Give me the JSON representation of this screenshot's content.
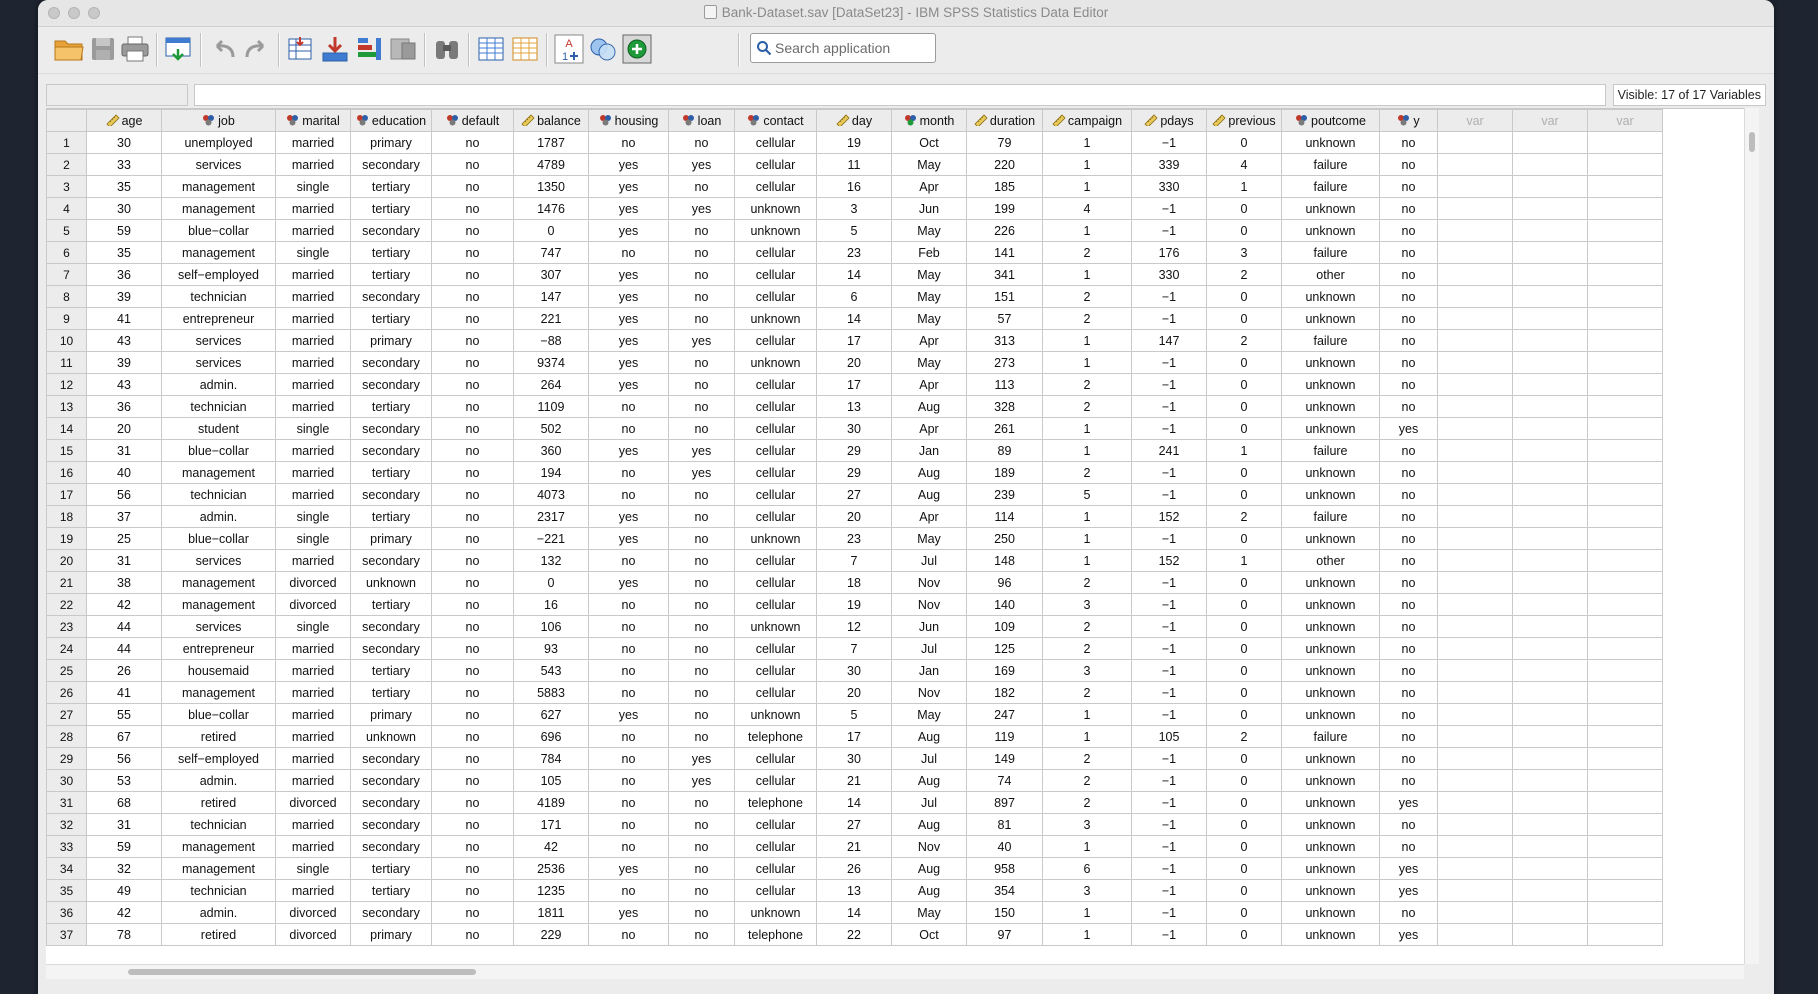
{
  "window": {
    "title": "Bank-Dataset.sav [DataSet23] - IBM SPSS Statistics Data Editor"
  },
  "toolbar": {
    "buttons": [
      {
        "name": "open-data-document",
        "icon": "folder-open-icon"
      },
      {
        "name": "save-document",
        "icon": "save-disk-icon"
      },
      {
        "name": "print",
        "icon": "printer-icon"
      },
      {
        "name": "recall-dialog",
        "icon": "recall-dialog-icon"
      },
      {
        "name": "undo",
        "icon": "undo-arrow-icon"
      },
      {
        "name": "redo",
        "icon": "redo-arrow-icon"
      },
      {
        "name": "go-to-case",
        "icon": "go-to-case-icon"
      },
      {
        "name": "go-to-variable",
        "icon": "go-to-variable-icon"
      },
      {
        "name": "variables",
        "icon": "variables-list-icon"
      },
      {
        "name": "run-descriptive-statistics",
        "icon": "descriptives-icon"
      },
      {
        "name": "find",
        "icon": "binoculars-icon"
      },
      {
        "name": "insert-cases",
        "icon": "insert-cases-icon"
      },
      {
        "name": "insert-variable",
        "icon": "insert-variable-icon"
      },
      {
        "name": "split-file",
        "icon": "split-file-icon"
      },
      {
        "name": "value-labels",
        "icon": "value-labels-icon"
      },
      {
        "name": "use-variable-sets",
        "icon": "use-sets-icon"
      },
      {
        "name": "customize-toolbar",
        "icon": "add-plus-icon"
      }
    ],
    "search_placeholder": "Search application"
  },
  "status": {
    "visible_vars": "Visible: 17 of 17 Variables"
  },
  "grid": {
    "columns": [
      {
        "name": "age",
        "type": "scale"
      },
      {
        "name": "job",
        "type": "nominal"
      },
      {
        "name": "marital",
        "type": "nominal"
      },
      {
        "name": "education",
        "type": "nominal"
      },
      {
        "name": "default",
        "type": "nominal"
      },
      {
        "name": "balance",
        "type": "scale"
      },
      {
        "name": "housing",
        "type": "nominal"
      },
      {
        "name": "loan",
        "type": "nominal"
      },
      {
        "name": "contact",
        "type": "nominal"
      },
      {
        "name": "day",
        "type": "scale"
      },
      {
        "name": "month",
        "type": "nominal-multi"
      },
      {
        "name": "duration",
        "type": "scale"
      },
      {
        "name": "campaign",
        "type": "scale"
      },
      {
        "name": "pdays",
        "type": "scale"
      },
      {
        "name": "previous",
        "type": "scale"
      },
      {
        "name": "poutcome",
        "type": "nominal"
      },
      {
        "name": "y",
        "type": "nominal"
      }
    ],
    "empty_columns": [
      "var",
      "var",
      "var"
    ],
    "rows": [
      [
        "30",
        "unemployed",
        "married",
        "primary",
        "no",
        "1787",
        "no",
        "no",
        "cellular",
        "19",
        "Oct",
        "79",
        "1",
        "-1",
        "0",
        "unknown",
        "no"
      ],
      [
        "33",
        "services",
        "married",
        "secondary",
        "no",
        "4789",
        "yes",
        "yes",
        "cellular",
        "11",
        "May",
        "220",
        "1",
        "339",
        "4",
        "failure",
        "no"
      ],
      [
        "35",
        "management",
        "single",
        "tertiary",
        "no",
        "1350",
        "yes",
        "no",
        "cellular",
        "16",
        "Apr",
        "185",
        "1",
        "330",
        "1",
        "failure",
        "no"
      ],
      [
        "30",
        "management",
        "married",
        "tertiary",
        "no",
        "1476",
        "yes",
        "yes",
        "unknown",
        "3",
        "Jun",
        "199",
        "4",
        "-1",
        "0",
        "unknown",
        "no"
      ],
      [
        "59",
        "blue-collar",
        "married",
        "secondary",
        "no",
        "0",
        "yes",
        "no",
        "unknown",
        "5",
        "May",
        "226",
        "1",
        "-1",
        "0",
        "unknown",
        "no"
      ],
      [
        "35",
        "management",
        "single",
        "tertiary",
        "no",
        "747",
        "no",
        "no",
        "cellular",
        "23",
        "Feb",
        "141",
        "2",
        "176",
        "3",
        "failure",
        "no"
      ],
      [
        "36",
        "self-employed",
        "married",
        "tertiary",
        "no",
        "307",
        "yes",
        "no",
        "cellular",
        "14",
        "May",
        "341",
        "1",
        "330",
        "2",
        "other",
        "no"
      ],
      [
        "39",
        "technician",
        "married",
        "secondary",
        "no",
        "147",
        "yes",
        "no",
        "cellular",
        "6",
        "May",
        "151",
        "2",
        "-1",
        "0",
        "unknown",
        "no"
      ],
      [
        "41",
        "entrepreneur",
        "married",
        "tertiary",
        "no",
        "221",
        "yes",
        "no",
        "unknown",
        "14",
        "May",
        "57",
        "2",
        "-1",
        "0",
        "unknown",
        "no"
      ],
      [
        "43",
        "services",
        "married",
        "primary",
        "no",
        "-88",
        "yes",
        "yes",
        "cellular",
        "17",
        "Apr",
        "313",
        "1",
        "147",
        "2",
        "failure",
        "no"
      ],
      [
        "39",
        "services",
        "married",
        "secondary",
        "no",
        "9374",
        "yes",
        "no",
        "unknown",
        "20",
        "May",
        "273",
        "1",
        "-1",
        "0",
        "unknown",
        "no"
      ],
      [
        "43",
        "admin.",
        "married",
        "secondary",
        "no",
        "264",
        "yes",
        "no",
        "cellular",
        "17",
        "Apr",
        "113",
        "2",
        "-1",
        "0",
        "unknown",
        "no"
      ],
      [
        "36",
        "technician",
        "married",
        "tertiary",
        "no",
        "1109",
        "no",
        "no",
        "cellular",
        "13",
        "Aug",
        "328",
        "2",
        "-1",
        "0",
        "unknown",
        "no"
      ],
      [
        "20",
        "student",
        "single",
        "secondary",
        "no",
        "502",
        "no",
        "no",
        "cellular",
        "30",
        "Apr",
        "261",
        "1",
        "-1",
        "0",
        "unknown",
        "yes"
      ],
      [
        "31",
        "blue-collar",
        "married",
        "secondary",
        "no",
        "360",
        "yes",
        "yes",
        "cellular",
        "29",
        "Jan",
        "89",
        "1",
        "241",
        "1",
        "failure",
        "no"
      ],
      [
        "40",
        "management",
        "married",
        "tertiary",
        "no",
        "194",
        "no",
        "yes",
        "cellular",
        "29",
        "Aug",
        "189",
        "2",
        "-1",
        "0",
        "unknown",
        "no"
      ],
      [
        "56",
        "technician",
        "married",
        "secondary",
        "no",
        "4073",
        "no",
        "no",
        "cellular",
        "27",
        "Aug",
        "239",
        "5",
        "-1",
        "0",
        "unknown",
        "no"
      ],
      [
        "37",
        "admin.",
        "single",
        "tertiary",
        "no",
        "2317",
        "yes",
        "no",
        "cellular",
        "20",
        "Apr",
        "114",
        "1",
        "152",
        "2",
        "failure",
        "no"
      ],
      [
        "25",
        "blue-collar",
        "single",
        "primary",
        "no",
        "-221",
        "yes",
        "no",
        "unknown",
        "23",
        "May",
        "250",
        "1",
        "-1",
        "0",
        "unknown",
        "no"
      ],
      [
        "31",
        "services",
        "married",
        "secondary",
        "no",
        "132",
        "no",
        "no",
        "cellular",
        "7",
        "Jul",
        "148",
        "1",
        "152",
        "1",
        "other",
        "no"
      ],
      [
        "38",
        "management",
        "divorced",
        "unknown",
        "no",
        "0",
        "yes",
        "no",
        "cellular",
        "18",
        "Nov",
        "96",
        "2",
        "-1",
        "0",
        "unknown",
        "no"
      ],
      [
        "42",
        "management",
        "divorced",
        "tertiary",
        "no",
        "16",
        "no",
        "no",
        "cellular",
        "19",
        "Nov",
        "140",
        "3",
        "-1",
        "0",
        "unknown",
        "no"
      ],
      [
        "44",
        "services",
        "single",
        "secondary",
        "no",
        "106",
        "no",
        "no",
        "unknown",
        "12",
        "Jun",
        "109",
        "2",
        "-1",
        "0",
        "unknown",
        "no"
      ],
      [
        "44",
        "entrepreneur",
        "married",
        "secondary",
        "no",
        "93",
        "no",
        "no",
        "cellular",
        "7",
        "Jul",
        "125",
        "2",
        "-1",
        "0",
        "unknown",
        "no"
      ],
      [
        "26",
        "housemaid",
        "married",
        "tertiary",
        "no",
        "543",
        "no",
        "no",
        "cellular",
        "30",
        "Jan",
        "169",
        "3",
        "-1",
        "0",
        "unknown",
        "no"
      ],
      [
        "41",
        "management",
        "married",
        "tertiary",
        "no",
        "5883",
        "no",
        "no",
        "cellular",
        "20",
        "Nov",
        "182",
        "2",
        "-1",
        "0",
        "unknown",
        "no"
      ],
      [
        "55",
        "blue-collar",
        "married",
        "primary",
        "no",
        "627",
        "yes",
        "no",
        "unknown",
        "5",
        "May",
        "247",
        "1",
        "-1",
        "0",
        "unknown",
        "no"
      ],
      [
        "67",
        "retired",
        "married",
        "unknown",
        "no",
        "696",
        "no",
        "no",
        "telephone",
        "17",
        "Aug",
        "119",
        "1",
        "105",
        "2",
        "failure",
        "no"
      ],
      [
        "56",
        "self-employed",
        "married",
        "secondary",
        "no",
        "784",
        "no",
        "yes",
        "cellular",
        "30",
        "Jul",
        "149",
        "2",
        "-1",
        "0",
        "unknown",
        "no"
      ],
      [
        "53",
        "admin.",
        "married",
        "secondary",
        "no",
        "105",
        "no",
        "yes",
        "cellular",
        "21",
        "Aug",
        "74",
        "2",
        "-1",
        "0",
        "unknown",
        "no"
      ],
      [
        "68",
        "retired",
        "divorced",
        "secondary",
        "no",
        "4189",
        "no",
        "no",
        "telephone",
        "14",
        "Jul",
        "897",
        "2",
        "-1",
        "0",
        "unknown",
        "yes"
      ],
      [
        "31",
        "technician",
        "married",
        "secondary",
        "no",
        "171",
        "no",
        "no",
        "cellular",
        "27",
        "Aug",
        "81",
        "3",
        "-1",
        "0",
        "unknown",
        "no"
      ],
      [
        "59",
        "management",
        "married",
        "secondary",
        "no",
        "42",
        "no",
        "no",
        "cellular",
        "21",
        "Nov",
        "40",
        "1",
        "-1",
        "0",
        "unknown",
        "no"
      ],
      [
        "32",
        "management",
        "single",
        "tertiary",
        "no",
        "2536",
        "yes",
        "no",
        "cellular",
        "26",
        "Aug",
        "958",
        "6",
        "-1",
        "0",
        "unknown",
        "yes"
      ],
      [
        "49",
        "technician",
        "married",
        "tertiary",
        "no",
        "1235",
        "no",
        "no",
        "cellular",
        "13",
        "Aug",
        "354",
        "3",
        "-1",
        "0",
        "unknown",
        "yes"
      ],
      [
        "42",
        "admin.",
        "divorced",
        "secondary",
        "no",
        "1811",
        "yes",
        "no",
        "unknown",
        "14",
        "May",
        "150",
        "1",
        "-1",
        "0",
        "unknown",
        "no"
      ],
      [
        "78",
        "retired",
        "divorced",
        "primary",
        "no",
        "229",
        "no",
        "no",
        "telephone",
        "22",
        "Oct",
        "97",
        "1",
        "-1",
        "0",
        "unknown",
        "yes"
      ]
    ]
  }
}
